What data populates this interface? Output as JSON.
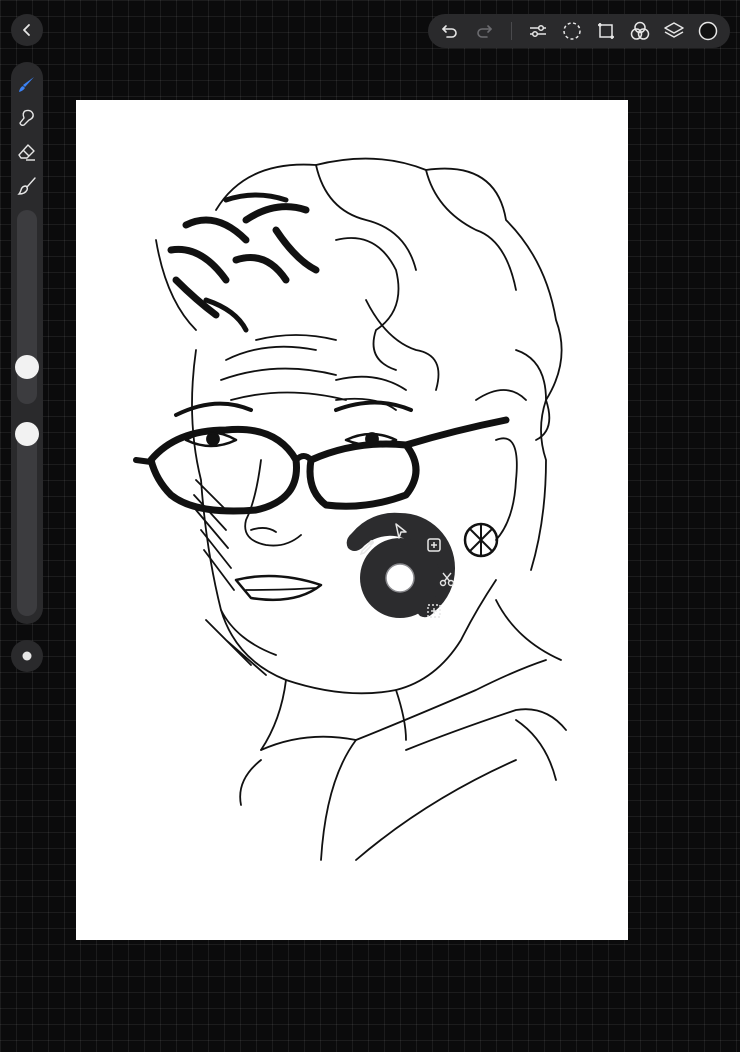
{
  "app": {
    "accent_color": "#3b82f6",
    "panel_color": "#2a2a2c",
    "canvas_color": "#ffffff"
  },
  "back_button": {
    "icon": "chevron-left-icon"
  },
  "toolbar": {
    "icons": [
      "undo-icon",
      "redo-icon",
      "adjust-icon",
      "selection-icon",
      "transform-icon",
      "blend-icon",
      "layers-icon",
      "color-icon"
    ]
  },
  "sidebar": {
    "tools": [
      "brush-icon",
      "smudge-icon",
      "eraser-icon",
      "paint-brush-icon"
    ],
    "active_tool": "brush-icon",
    "brush_size_fraction": 0.15,
    "opacity_fraction": 1.0
  },
  "quick_menu": {
    "items": [
      "eyedropper-icon",
      "cursor-icon",
      "duplicate-icon",
      "scissors-icon",
      "select-area-icon"
    ]
  }
}
